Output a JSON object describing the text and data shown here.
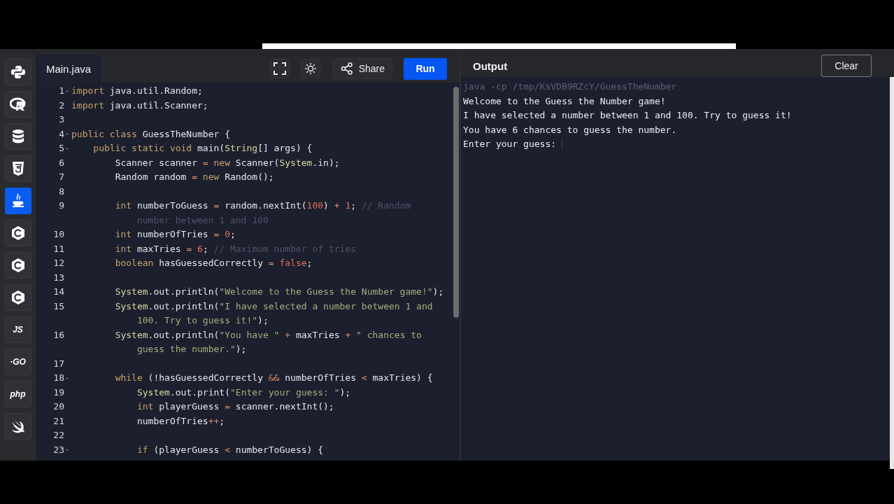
{
  "sidebar": {
    "items": [
      {
        "kind": "snake",
        "selected": false
      },
      {
        "kind": "ring",
        "selected": false
      },
      {
        "kind": "database",
        "selected": false
      },
      {
        "kind": "shield",
        "selected": false
      },
      {
        "kind": "cup",
        "selected": true
      },
      {
        "kind": "hexagon",
        "selected": false
      },
      {
        "kind": "hexagon",
        "selected": false
      },
      {
        "kind": "hexagon",
        "selected": false
      },
      {
        "kind": "label",
        "label": "JS",
        "selected": false
      },
      {
        "kind": "label",
        "label": "·GO",
        "selected": false
      },
      {
        "kind": "label",
        "label": "php",
        "selected": false
      },
      {
        "kind": "bird",
        "selected": false
      }
    ]
  },
  "editor": {
    "tab": {
      "label": "Main.java",
      "selected": true
    },
    "share": {
      "label": "Share"
    },
    "run": {
      "label": "Run"
    },
    "lines": [
      {
        "number": "1",
        "fold": true,
        "tokens": [
          {
            "t": "import",
            "kind": "kw"
          },
          {
            "t": " java.util.Random;",
            "kind": "pl"
          }
        ]
      },
      {
        "number": "2",
        "fold": false,
        "tokens": [
          {
            "t": "import",
            "kind": "kw"
          },
          {
            "t": " java.util.Scanner;",
            "kind": "pl"
          }
        ]
      },
      {
        "number": "3",
        "fold": false
      },
      {
        "number": "4",
        "fold": true,
        "tokens": [
          {
            "t": "public class",
            "kind": "kw"
          },
          {
            "t": " GuessTheNumber {",
            "kind": "pl"
          }
        ]
      },
      {
        "number": "5",
        "fold": true,
        "tokens": [
          {
            "t": "    public static void",
            "kind": "kw"
          },
          {
            "t": " main(",
            "kind": "pl"
          },
          {
            "t": "String",
            "kind": "cls"
          },
          {
            "t": "[] args) {",
            "kind": "pl"
          }
        ]
      },
      {
        "number": "6",
        "fold": false,
        "tokens": [
          {
            "t": "        Scanner scanner ",
            "kind": "pl"
          },
          {
            "t": "= ",
            "kind": "op"
          },
          {
            "t": "new",
            "kind": "kw"
          },
          {
            "t": " Scanner(",
            "kind": "pl"
          },
          {
            "t": "System",
            "kind": "cls"
          },
          {
            "t": ".in);",
            "kind": "pl"
          }
        ]
      },
      {
        "number": "7",
        "fold": false,
        "tokens": [
          {
            "t": "        Random random ",
            "kind": "pl"
          },
          {
            "t": "= ",
            "kind": "op"
          },
          {
            "t": "new",
            "kind": "kw"
          },
          {
            "t": " Random();",
            "kind": "pl"
          }
        ]
      },
      {
        "number": "8",
        "fold": false
      },
      {
        "number": "9",
        "fold": false,
        "tokens": [
          {
            "t": "        int",
            "kind": "kw"
          },
          {
            "t": " numberToGuess ",
            "kind": "pl"
          },
          {
            "t": "=",
            "kind": "op"
          },
          {
            "t": " random.nextInt(",
            "kind": "pl"
          },
          {
            "t": "100",
            "kind": "num"
          },
          {
            "t": ") ",
            "kind": "pl"
          },
          {
            "t": "+ ",
            "kind": "op"
          },
          {
            "t": "1",
            "kind": "num"
          },
          {
            "t": "; ",
            "kind": "pl"
          },
          {
            "t": "// Random number between 1 and 100",
            "kind": "cm"
          }
        ]
      },
      {
        "number": "10",
        "fold": false,
        "tokens": [
          {
            "t": "        int",
            "kind": "kw"
          },
          {
            "t": " numberOfTries ",
            "kind": "pl"
          },
          {
            "t": "= ",
            "kind": "op"
          },
          {
            "t": "0",
            "kind": "num"
          },
          {
            "t": ";",
            "kind": "pl"
          }
        ]
      },
      {
        "number": "11",
        "fold": false,
        "tokens": [
          {
            "t": "        int",
            "kind": "kw"
          },
          {
            "t": " maxTries ",
            "kind": "pl"
          },
          {
            "t": "= ",
            "kind": "op"
          },
          {
            "t": "6",
            "kind": "num"
          },
          {
            "t": "; ",
            "kind": "pl"
          },
          {
            "t": "// Maximum number of tries",
            "kind": "cm"
          }
        ]
      },
      {
        "number": "12",
        "fold": false,
        "tokens": [
          {
            "t": "        boolean",
            "kind": "kw"
          },
          {
            "t": " hasGuessedCorrectly ",
            "kind": "pl"
          },
          {
            "t": "= ",
            "kind": "op"
          },
          {
            "t": "false",
            "kind": "num"
          },
          {
            "t": ";",
            "kind": "pl"
          }
        ]
      },
      {
        "number": "13",
        "fold": false
      },
      {
        "number": "14",
        "fold": false,
        "tokens": [
          {
            "t": "        System",
            "kind": "cls"
          },
          {
            "t": ".out.println(",
            "kind": "pl"
          },
          {
            "t": "\"Welcome to the Guess the Number game!\"",
            "kind": "str"
          },
          {
            "t": ");",
            "kind": "pl"
          }
        ]
      },
      {
        "number": "15",
        "fold": false,
        "tokens": [
          {
            "t": "        System",
            "kind": "cls"
          },
          {
            "t": ".out.println(",
            "kind": "pl"
          },
          {
            "t": "\"I have selected a number between 1 and 100. Try to guess it!\"",
            "kind": "str"
          },
          {
            "t": ");",
            "kind": "pl"
          }
        ]
      },
      {
        "number": "16",
        "fold": false,
        "tokens": [
          {
            "t": "        System",
            "kind": "cls"
          },
          {
            "t": ".out.println(",
            "kind": "pl"
          },
          {
            "t": "\"You have \" ",
            "kind": "str"
          },
          {
            "t": "+",
            "kind": "op"
          },
          {
            "t": " maxTries ",
            "kind": "pl"
          },
          {
            "t": "+ ",
            "kind": "op"
          },
          {
            "t": "\" chances to guess the number.\"",
            "kind": "str"
          },
          {
            "t": ");",
            "kind": "pl"
          }
        ]
      },
      {
        "number": "17",
        "fold": false
      },
      {
        "number": "18",
        "fold": true,
        "tokens": [
          {
            "t": "        while",
            "kind": "kw"
          },
          {
            "t": " (!hasGuessedCorrectly ",
            "kind": "pl"
          },
          {
            "t": "&&",
            "kind": "op"
          },
          {
            "t": " numberOfTries ",
            "kind": "pl"
          },
          {
            "t": "<",
            "kind": "op"
          },
          {
            "t": " maxTries) {",
            "kind": "pl"
          }
        ]
      },
      {
        "number": "19",
        "fold": false,
        "tokens": [
          {
            "t": "            System",
            "kind": "cls"
          },
          {
            "t": ".out.print(",
            "kind": "pl"
          },
          {
            "t": "\"Enter your guess: \"",
            "kind": "str"
          },
          {
            "t": ");",
            "kind": "pl"
          }
        ]
      },
      {
        "number": "20",
        "fold": false,
        "tokens": [
          {
            "t": "            int",
            "kind": "kw"
          },
          {
            "t": " playerGuess ",
            "kind": "pl"
          },
          {
            "t": "=",
            "kind": "op"
          },
          {
            "t": " scanner.nextInt();",
            "kind": "pl"
          }
        ]
      },
      {
        "number": "21",
        "fold": false,
        "tokens": [
          {
            "t": "            numberOfTries",
            "kind": "pl"
          },
          {
            "t": "++",
            "kind": "op"
          },
          {
            "t": ";",
            "kind": "pl"
          }
        ]
      },
      {
        "number": "22",
        "fold": false
      },
      {
        "number": "23",
        "fold": true,
        "tokens": [
          {
            "t": "            if",
            "kind": "kw"
          },
          {
            "t": " (playerGuess ",
            "kind": "pl"
          },
          {
            "t": "<",
            "kind": "op"
          },
          {
            "t": " numberToGuess) {",
            "kind": "pl"
          }
        ]
      }
    ]
  },
  "output": {
    "title": "Output",
    "clear": {
      "label": "Clear"
    },
    "lines": [
      {
        "kind": "command",
        "text": "java -cp /tmp/KsVDB9RZcY/GuessTheNumber"
      },
      {
        "kind": "stdout",
        "text": "Welcome to the Guess the Number game!"
      },
      {
        "kind": "stdout",
        "text": "I have selected a number between 1 and 100. Try to guess it!"
      },
      {
        "kind": "stdout",
        "text": "You have 6 chances to guess the number."
      },
      {
        "kind": "prompt",
        "text": "Enter your guess:"
      }
    ]
  }
}
